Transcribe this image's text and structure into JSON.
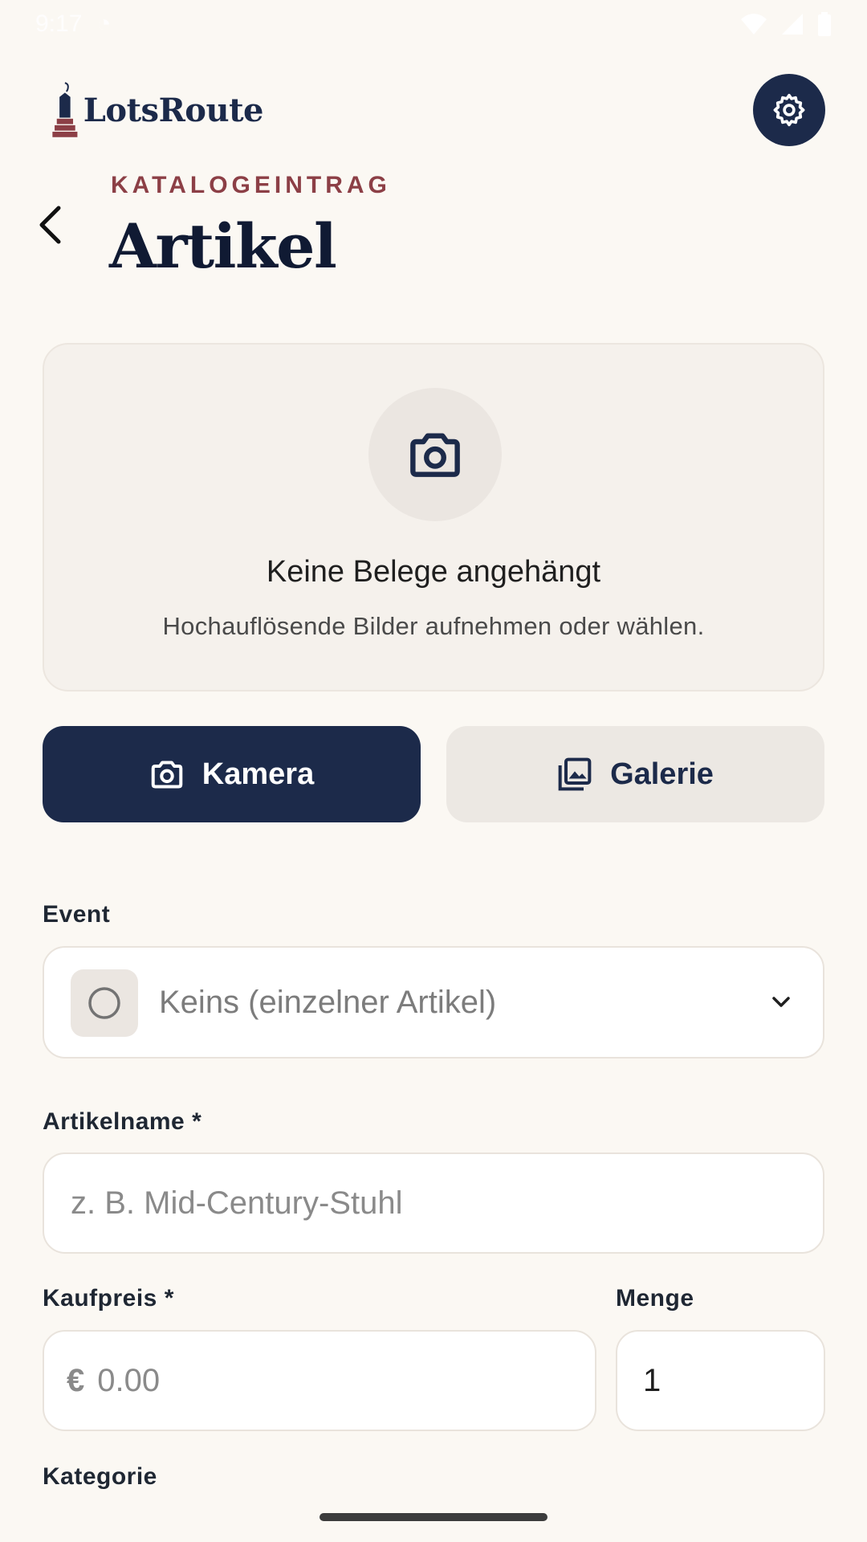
{
  "status_bar": {
    "time": "9:17"
  },
  "header": {
    "logo_text": "LotsRoute",
    "eyebrow": "KATALOGEINTRAG",
    "title": "Artikel"
  },
  "photo_card": {
    "title": "Keine Belege angehängt",
    "subtitle": "Hochauflösende Bilder aufnehmen oder wählen."
  },
  "buttons": {
    "camera_label": "Kamera",
    "gallery_label": "Galerie"
  },
  "form": {
    "event": {
      "label": "Event",
      "value": "Keins (einzelner Artikel)"
    },
    "item_name": {
      "label": "Artikelname *",
      "placeholder": "z. B. Mid-Century-Stuhl"
    },
    "price": {
      "label": "Kaufpreis *",
      "currency": "€",
      "placeholder": "0.00"
    },
    "quantity": {
      "label": "Menge",
      "value": "1"
    },
    "category": {
      "label": "Kategorie"
    }
  },
  "colors": {
    "primary": "#1c2a4a",
    "accent": "#8c3f46",
    "background": "#fbf8f3",
    "card": "#f5f1ec"
  },
  "icons": [
    "tag-logo-icon",
    "gear-icon",
    "chevron-left-icon",
    "camera-icon",
    "gallery-icon",
    "radio-icon",
    "chevron-down-icon"
  ]
}
